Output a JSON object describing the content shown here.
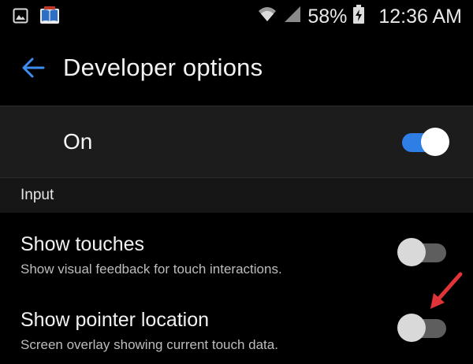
{
  "status_bar": {
    "icons_left": [
      "gallery-icon",
      "book-app-icon"
    ],
    "battery_percent": "58%",
    "time": "12:36 AM",
    "icons_right": [
      "wifi-icon",
      "signal-icon",
      "battery-charging-icon"
    ]
  },
  "app_bar": {
    "back_icon": "arrow-left-icon",
    "title": "Developer options"
  },
  "master_switch": {
    "label": "On",
    "enabled": true
  },
  "section": {
    "title": "Input"
  },
  "settings": [
    {
      "title": "Show touches",
      "summary": "Show visual feedback for touch interactions.",
      "enabled": false
    },
    {
      "title": "Show pointer location",
      "summary": "Screen overlay showing current touch data.",
      "enabled": false
    }
  ],
  "colors": {
    "accent": "#2f7ee6",
    "annotation_arrow": "#e0343a",
    "background": "#000000",
    "row_highlight": "#1c1c1c"
  }
}
